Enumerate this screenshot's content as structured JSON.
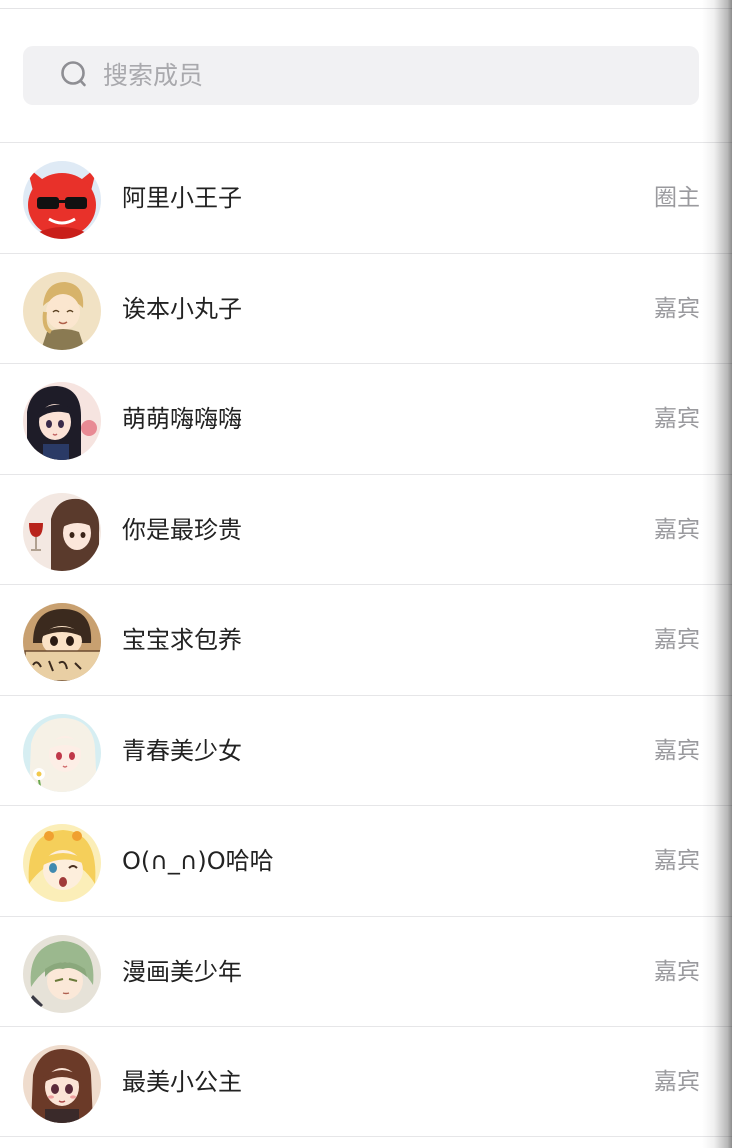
{
  "search": {
    "placeholder": "搜索成员"
  },
  "members": [
    {
      "name": "阿里小王子",
      "role": "圈主",
      "avatar_icon": "red-devil-sunglasses-avatar",
      "colors": [
        "#e8312a",
        "#ffffff"
      ]
    },
    {
      "name": "诶本小丸子",
      "role": "嘉宾",
      "avatar_icon": "blond-boy-avatar",
      "colors": [
        "#f0dfba",
        "#d9b46a"
      ]
    },
    {
      "name": "萌萌嗨嗨嗨",
      "role": "嘉宾",
      "avatar_icon": "dark-hair-girl-avatar",
      "colors": [
        "#f7e7e2",
        "#1e1c28"
      ]
    },
    {
      "name": "你是最珍贵",
      "role": "嘉宾",
      "avatar_icon": "brown-hair-girl-wine-avatar",
      "colors": [
        "#f3e6df",
        "#5a3a2c"
      ]
    },
    {
      "name": "宝宝求包养",
      "role": "嘉宾",
      "avatar_icon": "kid-holding-sign-avatar",
      "colors": [
        "#e9c99a",
        "#3b2a1e"
      ]
    },
    {
      "name": "青春美少女",
      "role": "嘉宾",
      "avatar_icon": "white-hair-girl-flower-avatar",
      "colors": [
        "#d8eef2",
        "#f3efe4"
      ]
    },
    {
      "name": "O(∩_∩)O哈哈",
      "role": "嘉宾",
      "avatar_icon": "blonde-girl-avatar",
      "colors": [
        "#fbe9a8",
        "#f5cf5a"
      ]
    },
    {
      "name": "漫画美少年",
      "role": "嘉宾",
      "avatar_icon": "green-hair-boy-avatar",
      "colors": [
        "#c7dcc0",
        "#8aa87c"
      ]
    },
    {
      "name": "最美小公主",
      "role": "嘉宾",
      "avatar_icon": "brown-hair-princess-avatar",
      "colors": [
        "#f1d9c8",
        "#6b3a28"
      ]
    }
  ]
}
